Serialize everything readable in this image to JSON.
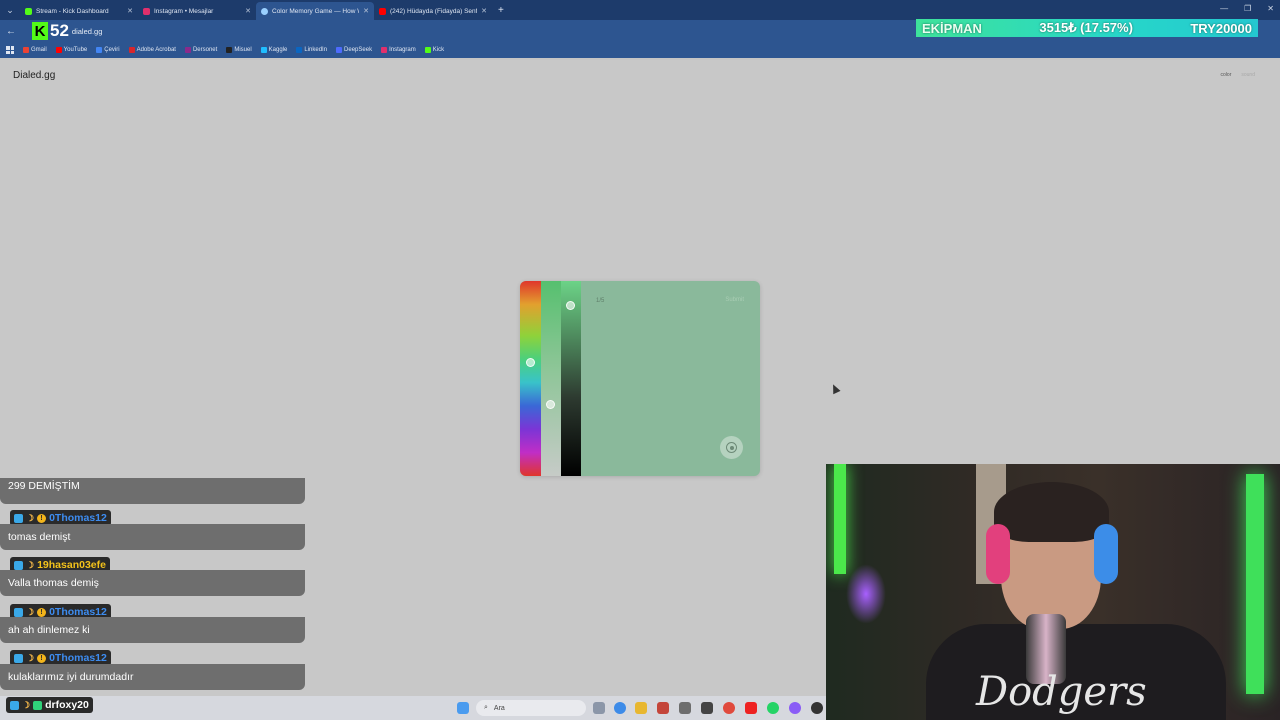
{
  "browser": {
    "tabs": [
      {
        "title": "Stream - Kick Dashboard",
        "fav": "#53fc18",
        "active": false
      },
      {
        "title": "Instagram • Mesajlar",
        "fav": "#e1306c",
        "active": false
      },
      {
        "title": "Color Memory Game — How W",
        "fav": "#9ad0ff",
        "active": true
      },
      {
        "title": "(242) Hüdayda (Fidayda) Senfo",
        "fav": "#ff0000",
        "active": false
      }
    ],
    "url": "dialed.gg",
    "bookmarks": [
      {
        "label": "Gmail",
        "color": "#ea4335"
      },
      {
        "label": "YouTube",
        "color": "#ff0000"
      },
      {
        "label": "Çeviri",
        "color": "#4285f4"
      },
      {
        "label": "Adobe Acrobat",
        "color": "#d7262c"
      },
      {
        "label": "Dersonet",
        "color": "#8b2a8b"
      },
      {
        "label": "Misuel",
        "color": "#222"
      },
      {
        "label": "Kaggle",
        "color": "#20beff"
      },
      {
        "label": "LinkedIn",
        "color": "#0a66c2"
      },
      {
        "label": "DeepSeek",
        "color": "#4d6bfe"
      },
      {
        "label": "Instagram",
        "color": "#e1306c"
      },
      {
        "label": "Kick",
        "color": "#53fc18"
      }
    ]
  },
  "overlay": {
    "kick_number": "52",
    "ticker": {
      "label": "EKİPMAN",
      "amount": "3515₺ (17.57%)",
      "goal": "TRY20000"
    }
  },
  "page": {
    "brand": "Dialed.gg",
    "nav_color": "color",
    "nav_sound": "sound"
  },
  "game": {
    "counter": "1/5",
    "submit_label": "Submit",
    "swatch_color": "#8ab99b"
  },
  "chat": {
    "messages": [
      {
        "user": "",
        "text": "299 DEMİŞTİM",
        "name_color": "white"
      },
      {
        "user": "0Thomas12",
        "text": "tomas demişt",
        "name_color": "blue"
      },
      {
        "user": "19hasan03efe",
        "text": "Valla thomas demiş",
        "name_color": "gold"
      },
      {
        "user": "0Thomas12",
        "text": "ah ah dinlemez ki",
        "name_color": "blue"
      },
      {
        "user": "0Thomas12",
        "text": "kulaklarımız iyi durumdadır",
        "name_color": "blue"
      },
      {
        "user": "drfoxy20",
        "text": "",
        "name_color": "white"
      }
    ]
  },
  "taskbar": {
    "search_placeholder": "Ara"
  },
  "webcam": {
    "shirt_text": "Dodgers"
  }
}
